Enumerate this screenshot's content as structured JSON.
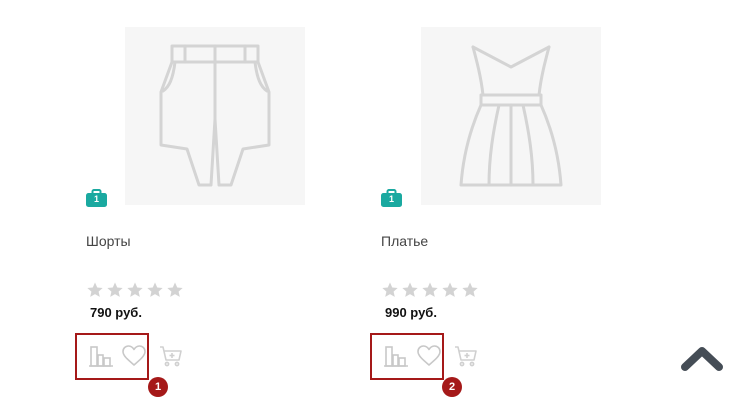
{
  "products": [
    {
      "title": "Шорты",
      "price": "790 руб.",
      "stock_badge": "1",
      "rating_stars": 0,
      "image_icon": "shorts-icon",
      "marker": "1"
    },
    {
      "title": "Платье",
      "price": "990 руб.",
      "stock_badge": "1",
      "rating_stars": 0,
      "image_icon": "dress-icon",
      "marker": "2"
    }
  ],
  "icons": {
    "compare": "compare-icon",
    "wishlist": "heart-icon",
    "cart": "cart-icon",
    "scroll_top": "chevron-up-icon",
    "star": "star-icon",
    "badge": "briefcase-icon"
  },
  "colors": {
    "badge": "#1aa9a0",
    "highlight": "#a51919",
    "star": "#d3d3d3",
    "icon": "#c8c8c8",
    "scroll_top": "#454d56"
  }
}
